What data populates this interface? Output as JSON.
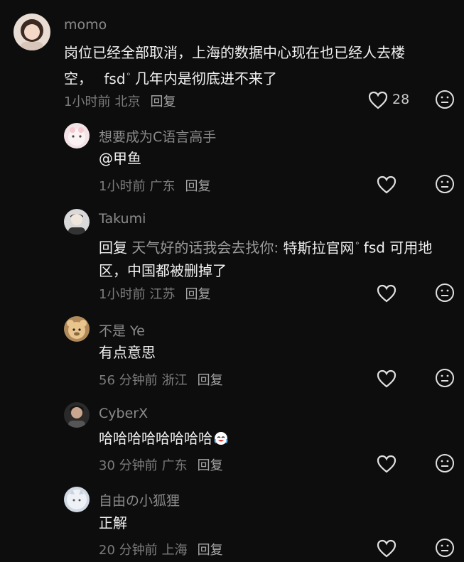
{
  "comments": [
    {
      "username": "momo",
      "line1": "岗位已经全部取消，上海的数据中心现在也已经人去楼",
      "line2_pre": "空，",
      "line2_link": "fsd",
      "line2_post": "几年内是彻底进不来了",
      "time": "1小时前",
      "location": "北京",
      "reply_label": "回复",
      "likes": "28"
    },
    {
      "username": "想要成为C语言高手",
      "text": "@甲鱼",
      "time": "1小时前",
      "location": "广东",
      "reply_label": "回复"
    },
    {
      "username": "Takumi",
      "reply_prefix": "回复",
      "reply_target": "天气好的话我会去找你:",
      "link1": "特斯拉官网",
      "rest1": "fsd 可用地",
      "line2": "区，中国都被删掉了",
      "time": "1小时前",
      "location": "江苏",
      "reply_label": "回复"
    },
    {
      "username": "不是 Ye",
      "text": "有点意思",
      "time": "56 分钟前",
      "location": "浙江",
      "reply_label": "回复"
    },
    {
      "username": "CyberX",
      "text": "哈哈哈哈哈哈哈哈",
      "time": "30 分钟前",
      "location": "广东",
      "reply_label": "回复"
    },
    {
      "username": "自由の小狐狸",
      "text": "正解",
      "time": "20 分钟前",
      "location": "上海",
      "reply_label": "回复"
    }
  ],
  "icons": {
    "like": "heart-outline-icon",
    "dislike": "meh-face-icon",
    "search": "search-icon"
  }
}
